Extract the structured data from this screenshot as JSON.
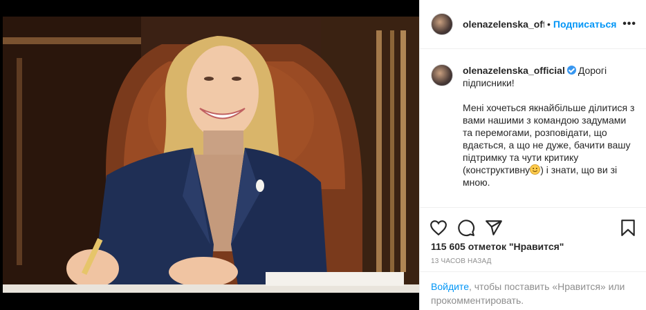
{
  "header": {
    "username": "olenazelenska_offici",
    "separator": "•",
    "follow_label": "Подписаться",
    "more_label": "•••"
  },
  "caption": {
    "username": "olenazelenska_official",
    "greeting": "Дорогі підписники!",
    "body": "Мені хочеться якнайбільше ділитися з вами нашими з командою задумами та перемогами, розповідати, що вдається, а що не дуже, бачити вашу підтримку та чути критику (конструктивну",
    "body_end": ") і знати, що ви зі мною."
  },
  "post": {
    "likes": "115 605 отметок \"Нравится\"",
    "timestamp": "13 ЧАСОВ НАЗАД"
  },
  "login_prompt": {
    "link": "Войдите",
    "text": ", чтобы поставить «Нравится» или прокомментировать."
  },
  "colors": {
    "accent": "#0095f6",
    "verified": "#3897f0",
    "muted": "#8e8e8e"
  },
  "icons": [
    "heart-icon",
    "comment-icon",
    "share-icon",
    "bookmark-icon",
    "verified-badge-icon",
    "smiley-emoji-icon"
  ]
}
